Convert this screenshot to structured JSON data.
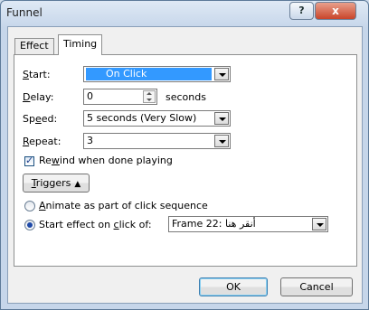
{
  "window": {
    "title": "Funnel",
    "help_label": "?",
    "close_label": "x"
  },
  "tabs": [
    {
      "label": "Effect"
    },
    {
      "label": "Timing"
    }
  ],
  "timing": {
    "start": {
      "label_pre": "",
      "label_ul": "S",
      "label_post": "tart:",
      "value": "On Click"
    },
    "delay": {
      "label_ul": "D",
      "label_post": "elay:",
      "value": "0",
      "unit": "seconds"
    },
    "speed": {
      "label_pre": "Sp",
      "label_ul": "e",
      "label_post": "ed:",
      "value": "5 seconds (Very Slow)"
    },
    "repeat": {
      "label_ul": "R",
      "label_post": "epeat:",
      "value": "3"
    },
    "rewind": {
      "label_pre": "Re",
      "label_ul": "w",
      "label_post": "ind when done playing",
      "checked": true
    },
    "triggers": {
      "label_ul": "T",
      "label_post": "riggers"
    },
    "animate_radio": {
      "label_ul": "A",
      "label_post": "nimate as part of click sequence",
      "selected": false
    },
    "start_on_click_radio": {
      "label_pre": "Start effect on ",
      "label_ul": "c",
      "label_post": "lick of:",
      "selected": true
    },
    "click_of_value": "Frame 22: أنقر هنا"
  },
  "footer": {
    "ok_label": "OK",
    "cancel_label": "Cancel"
  }
}
